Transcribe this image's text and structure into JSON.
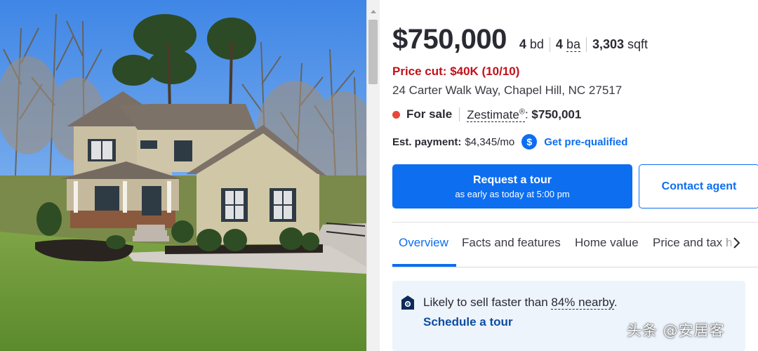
{
  "listing": {
    "price": "$750,000",
    "beds_value": "4",
    "beds_unit": "bd",
    "baths_value": "4",
    "baths_unit": "ba",
    "sqft_value": "3,303",
    "sqft_unit": "sqft",
    "price_cut": "Price cut: $40K (10/10)",
    "address": "24 Carter Walk Way, Chapel Hill, NC 27517",
    "status": "For sale",
    "zestimate_label": "Zestimate",
    "zestimate_reg": "®",
    "zestimate_colon": ":",
    "zestimate_value": "$750,001",
    "payment_label": "Est. payment:",
    "payment_value": "$4,345/mo",
    "dollar_glyph": "$",
    "prequal_link": "Get pre-qualified"
  },
  "actions": {
    "tour_title": "Request a tour",
    "tour_subtitle": "as early as today at 5:00 pm",
    "contact_label": "Contact agent"
  },
  "tabs": [
    {
      "label": "Overview",
      "active": true
    },
    {
      "label": "Facts and features",
      "active": false
    },
    {
      "label": "Home value",
      "active": false
    },
    {
      "label": "Price and tax h",
      "active": false
    }
  ],
  "insight": {
    "text_before": "Likely to sell faster than ",
    "highlight": "84% nearby",
    "text_after": ".",
    "link": "Schedule a tour"
  },
  "watermark": "头条 @安居客",
  "colors": {
    "accent": "#0d6ef0",
    "price_cut": "#c1111a",
    "status_dot": "#e8473e",
    "card_bg": "#eef4fc"
  },
  "icons": {
    "dollar": "dollar-circle-icon",
    "tab_next": "chevron-right-icon",
    "insight": "house-icon",
    "status": "status-dot-icon"
  }
}
